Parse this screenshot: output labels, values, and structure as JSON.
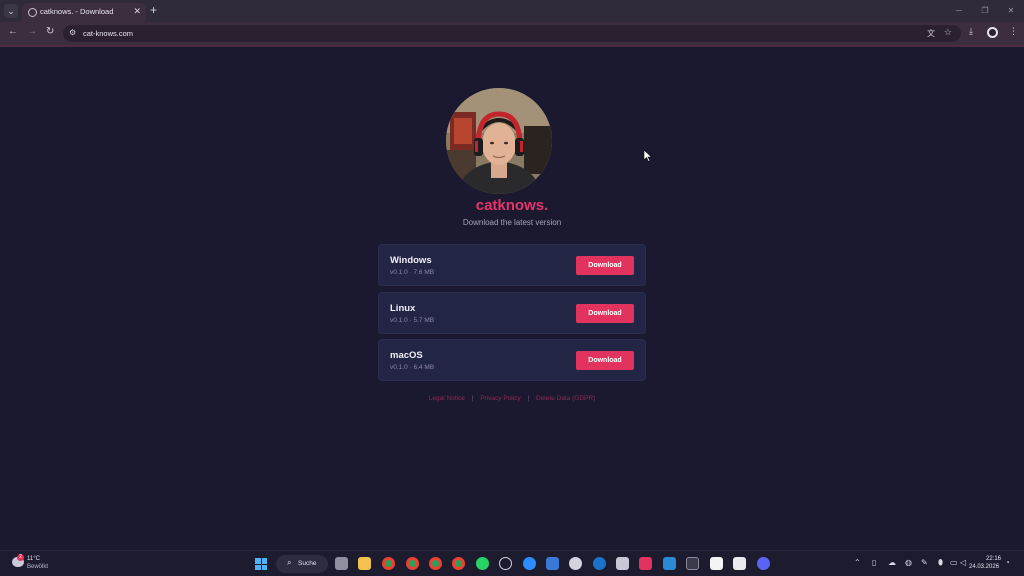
{
  "browser": {
    "tab_title": "catknows. - Download",
    "url": "cat-knows.com",
    "tab_menu_icon": "chevron-down-icon",
    "new_tab_glyph": "+",
    "close_glyph": "✕"
  },
  "page": {
    "brand": "catknows.",
    "subtitle": "Download the latest version",
    "downloads": [
      {
        "name": "Windows",
        "meta": "v0.1.0 · 7.6 MB",
        "button": "Download"
      },
      {
        "name": "Linux",
        "meta": "v0.1.0 · 5.7 MB",
        "button": "Download"
      },
      {
        "name": "macOS",
        "meta": "v0.1.0 · 6.4 MB",
        "button": "Download"
      }
    ],
    "footer": {
      "legal": "Legal Notice",
      "privacy": "Privacy Policy",
      "gdpr": "Delete Data (GDPR)",
      "separator": "|"
    }
  },
  "taskbar": {
    "weather_temp": "11°C",
    "weather_condition": "Bewölkt",
    "weather_badge": "2",
    "search_label": "Suche",
    "time": "22:16",
    "date": "24.03.2026"
  },
  "colors": {
    "accent": "#e2335f",
    "brand_text": "#e63468",
    "page_background": "#1b1930",
    "card_background": "#232545"
  }
}
